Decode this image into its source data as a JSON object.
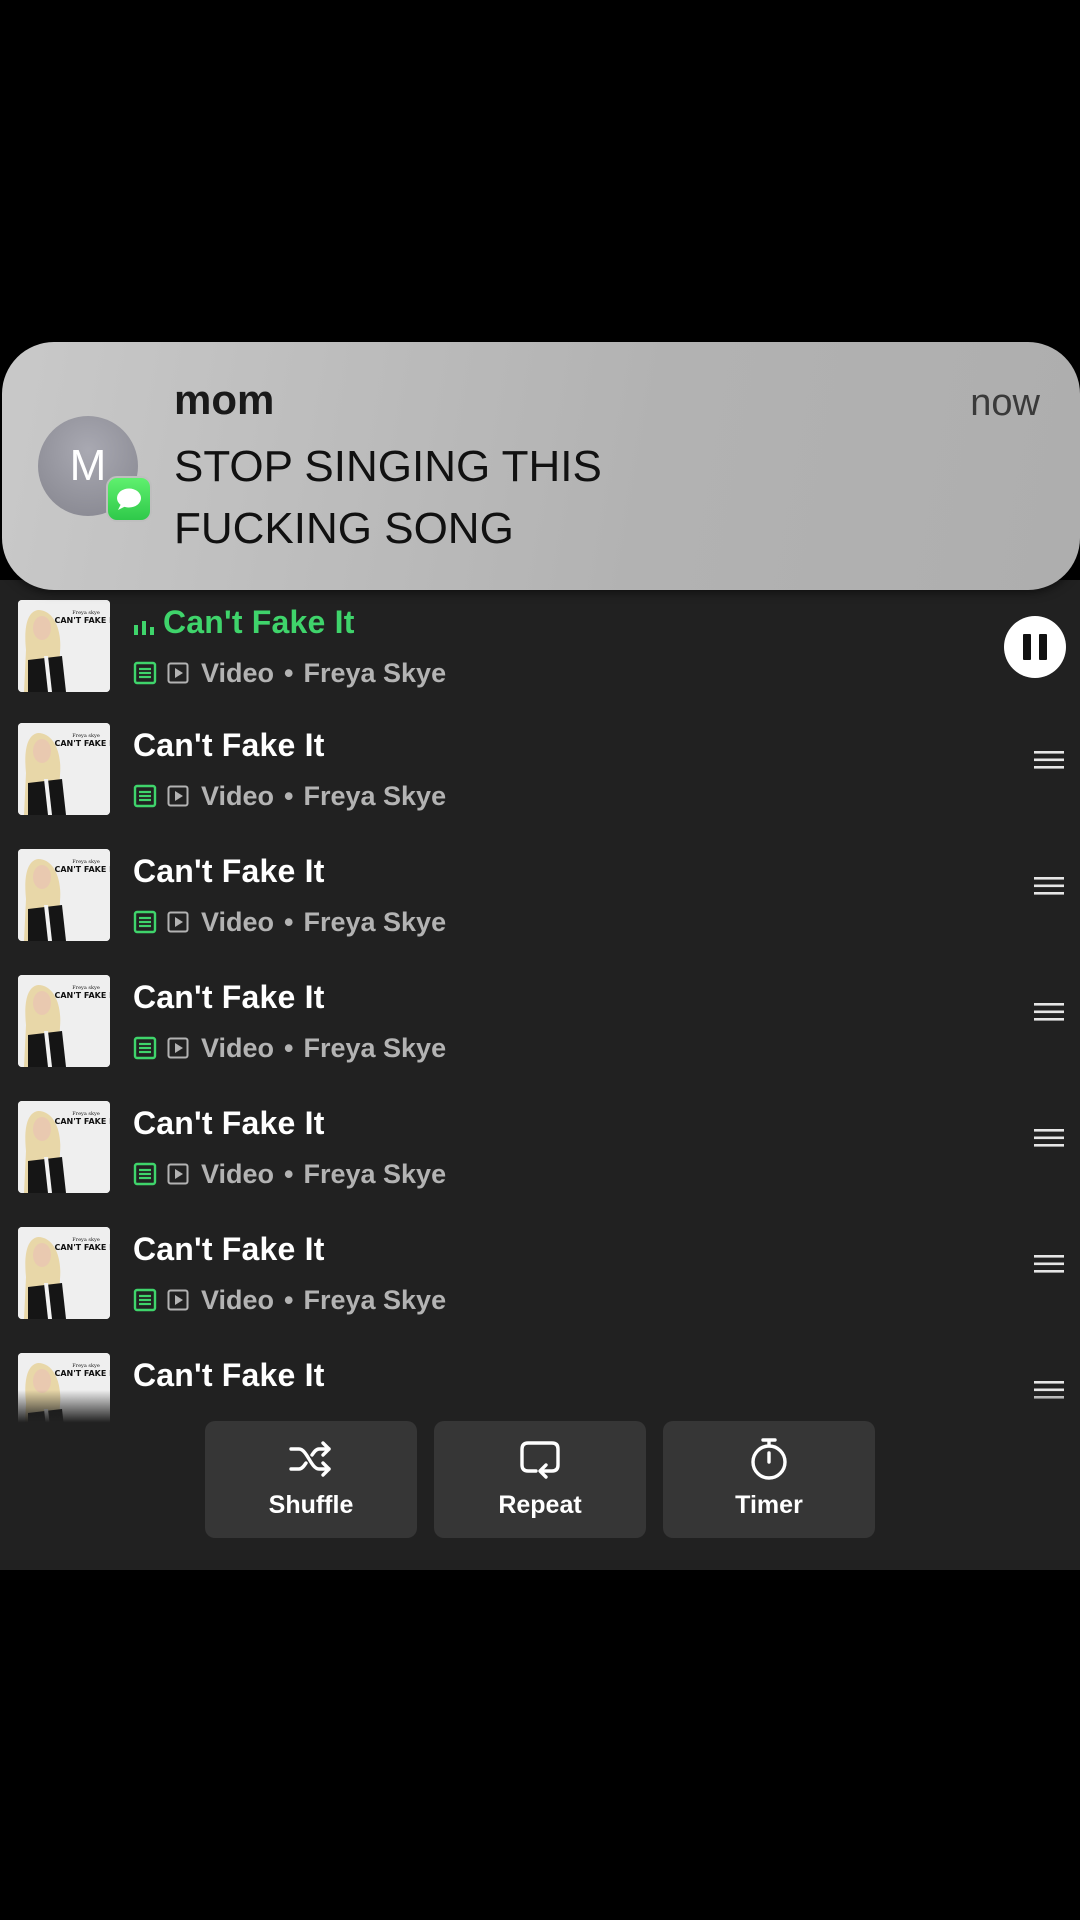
{
  "notification": {
    "sender": "mom",
    "time": "now",
    "avatar_letter": "M",
    "message": "STOP SINGING THIS FUCKING SONG",
    "app_icon": "messages-icon"
  },
  "queue": {
    "now_playing": {
      "title": "Can't Fake It",
      "type": "Video",
      "separator": "•",
      "artist": "Freya Skye",
      "status": "playing"
    },
    "items": [
      {
        "title": "Can't Fake It",
        "type": "Video",
        "separator": "•",
        "artist": "Freya Skye"
      },
      {
        "title": "Can't Fake It",
        "type": "Video",
        "separator": "•",
        "artist": "Freya Skye"
      },
      {
        "title": "Can't Fake It",
        "type": "Video",
        "separator": "•",
        "artist": "Freya Skye"
      },
      {
        "title": "Can't Fake It",
        "type": "Video",
        "separator": "•",
        "artist": "Freya Skye"
      },
      {
        "title": "Can't Fake It",
        "type": "Video",
        "separator": "•",
        "artist": "Freya Skye"
      },
      {
        "title": "Can't Fake It"
      }
    ]
  },
  "controls": {
    "shuffle_label": "Shuffle",
    "repeat_label": "Repeat",
    "timer_label": "Timer"
  },
  "colors": {
    "accent_green": "#3fd46b",
    "panel_bg": "#212121",
    "button_bg": "#363636"
  }
}
